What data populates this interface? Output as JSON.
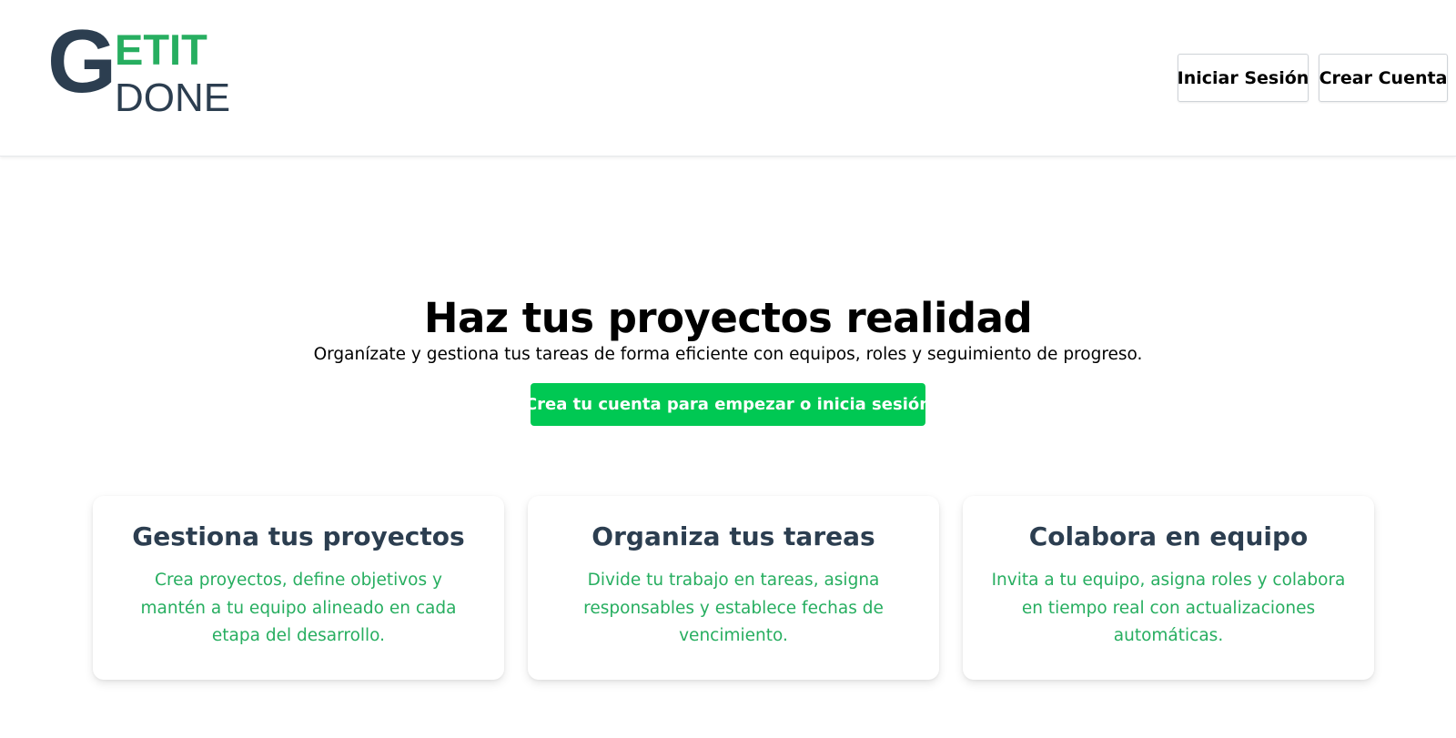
{
  "colors": {
    "logo_dark": "#2c3e50",
    "logo_green": "#27ae60",
    "cta_green": "#00c853",
    "heading_dark": "#2c3e50",
    "text_green": "#27ae60"
  },
  "header": {
    "logo": {
      "letter_g": "G",
      "etit": "ETIT",
      "done": "DONE"
    },
    "nav": {
      "login_label": "Iniciar Sesión",
      "signup_label": "Crear Cuenta"
    }
  },
  "hero": {
    "title": "Haz tus proyectos realidad",
    "subtitle": "Organízate y gestiona tus tareas de forma eficiente con equipos, roles y seguimiento de progreso.",
    "cta_label": "Crea tu cuenta para empezar o inicia sesión"
  },
  "features": [
    {
      "title": "Gestiona tus proyectos",
      "text": "Crea proyectos, define objetivos y mantén a tu equipo alineado en cada etapa del desarrollo."
    },
    {
      "title": "Organiza tus tareas",
      "text": "Divide tu trabajo en tareas, asigna responsables y establece fechas de vencimiento."
    },
    {
      "title": "Colabora en equipo",
      "text": "Invita a tu equipo, asigna roles y colabora en tiempo real con actualizaciones automáticas."
    }
  ]
}
